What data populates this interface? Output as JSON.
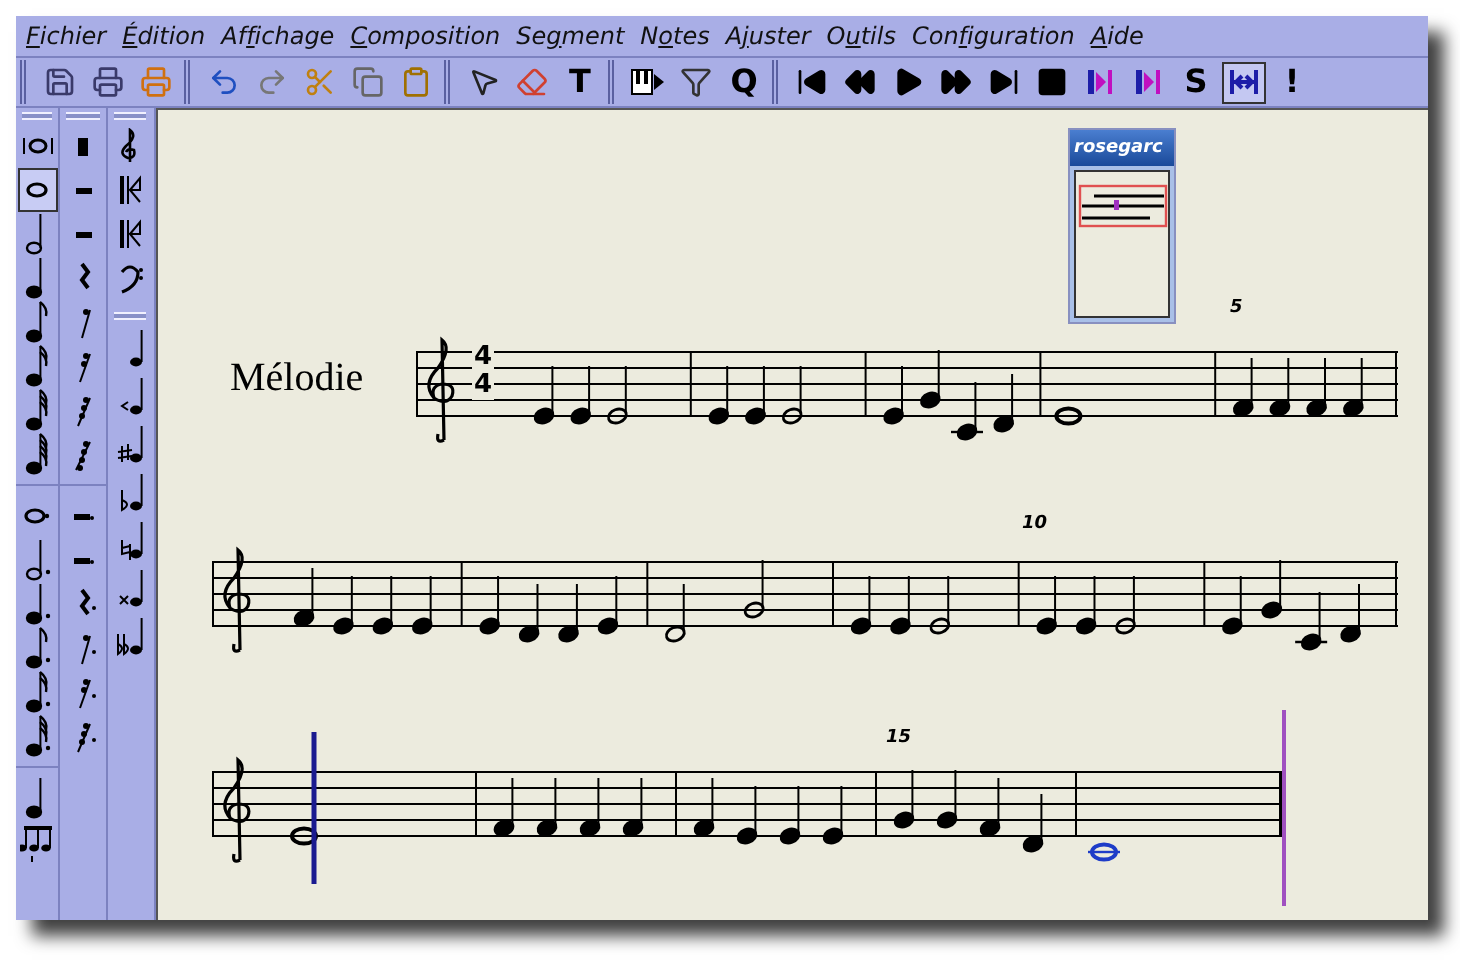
{
  "menu": [
    {
      "key": "F",
      "post": "ichier"
    },
    {
      "key": "É",
      "post": "dition"
    },
    {
      "pre": "Af",
      "key": "f",
      "post": "ichage"
    },
    {
      "key": "C",
      "post": "omposition"
    },
    {
      "pre": "Se",
      "key": "g",
      "post": "ment"
    },
    {
      "pre": "N",
      "key": "o",
      "post": "tes"
    },
    {
      "pre": "A",
      "key": "j",
      "post": "uster"
    },
    {
      "pre": "O",
      "key": "u",
      "post": "tils"
    },
    {
      "pre": "Con",
      "key": "f",
      "post": "iguration"
    },
    {
      "key": "A",
      "post": "ide"
    }
  ],
  "toolbar": [
    [
      {
        "kind": "icon",
        "pressed": false
      },
      {
        "kind": "icon",
        "pressed": false
      },
      {
        "kind": "icon",
        "pressed": false
      }
    ],
    [
      {
        "kind": "icon",
        "pressed": false
      },
      {
        "kind": "icon",
        "pressed": false
      },
      {
        "kind": "icon",
        "pressed": false
      },
      {
        "kind": "icon",
        "pressed": false
      },
      {
        "kind": "icon",
        "pressed": false
      }
    ],
    [
      {
        "kind": "icon",
        "pressed": false
      },
      {
        "kind": "icon",
        "pressed": false
      },
      {
        "kind": "glyph",
        "text": "T",
        "pressed": false
      }
    ],
    [
      {
        "kind": "icon",
        "pressed": false
      },
      {
        "kind": "icon",
        "pressed": false
      },
      {
        "kind": "glyph",
        "text": "Q",
        "pressed": false
      }
    ],
    [
      {
        "kind": "icon",
        "pressed": false
      },
      {
        "kind": "icon",
        "pressed": false
      },
      {
        "kind": "icon",
        "pressed": false
      },
      {
        "kind": "icon",
        "pressed": false
      },
      {
        "kind": "icon",
        "pressed": false
      },
      {
        "kind": "icon",
        "pressed": false
      },
      {
        "kind": "icon",
        "pressed": false
      },
      {
        "kind": "icon",
        "pressed": false
      },
      {
        "kind": "glyph",
        "text": "S",
        "pressed": false
      },
      {
        "kind": "icon",
        "pressed": true
      },
      {
        "kind": "glyph",
        "text": "!",
        "pressed": false
      }
    ]
  ],
  "note_palette": [
    {
      "selected": false
    },
    {
      "selected": true
    },
    {
      "selected": false
    },
    {
      "selected": false
    },
    {
      "selected": false
    },
    {
      "selected": false
    },
    {
      "selected": false
    },
    {
      "selected": false
    }
  ],
  "navigator": {
    "title": "rosegarc"
  },
  "score": {
    "staff_label": "Mélodie",
    "time_signature": {
      "numerator": "4",
      "denominator": "4"
    },
    "bar_numbers": [
      "5",
      "10",
      "15"
    ]
  }
}
